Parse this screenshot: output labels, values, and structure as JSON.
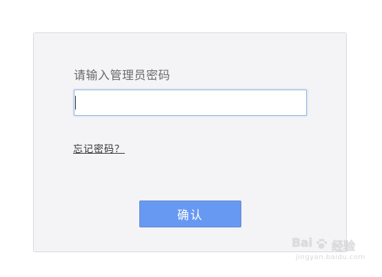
{
  "login": {
    "prompt": "请输入管理员密码",
    "password_value": "",
    "forgot_link": "忘记密码？",
    "confirm_button": "确认"
  },
  "watermark": {
    "brand": "Bai",
    "brand_suffix": "经验",
    "url": "jingyan.baidu.com"
  }
}
